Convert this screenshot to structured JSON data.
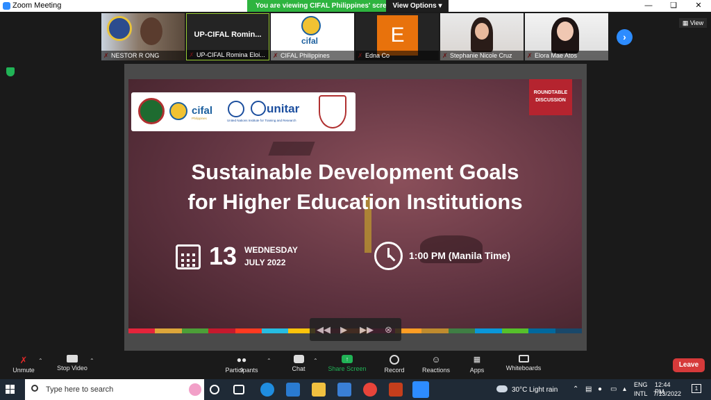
{
  "window": {
    "title": "Zoom Meeting"
  },
  "banner": {
    "viewing_text": "You are viewing CIFAL Philippines' screen",
    "view_options": "View Options"
  },
  "participants": [
    {
      "name": "NESTOR R ONG"
    },
    {
      "name": "UP-CIFAL Romina Eloi...",
      "video_label": "UP-CIFAL Romin..."
    },
    {
      "name": "CIFAL Philippines",
      "logo_text": "cifal"
    },
    {
      "name": "Edna Co",
      "avatar_letter": "E"
    },
    {
      "name": "Stephanie Nicole Cruz"
    },
    {
      "name": "Elora Mae Atos"
    }
  ],
  "view_button": "View",
  "slide": {
    "logo_cifal": "cifal",
    "logo_cifal_sub": "Philippines",
    "logo_unitar": "unitar",
    "logo_unitar_sub": "United Nations Institute for Training and Research",
    "badge_line1": "ROUNDTABLE",
    "badge_line2": "DISCUSSION",
    "headline_line1": "Sustainable Development Goals",
    "headline_line2": "for Higher Education Institutions",
    "day": "13",
    "weekday": "WEDNESDAY",
    "month_year": "JULY 2022",
    "time": "1:00 PM (Manila Time)",
    "sdg_colors": [
      "#e5243b",
      "#dda63a",
      "#4c9f38",
      "#c5192d",
      "#ff3a21",
      "#26bde2",
      "#fcc30b",
      "#a21942",
      "#fd6925",
      "#dd1367",
      "#fd9d24",
      "#bf8b2e",
      "#3f7e44",
      "#0a97d9",
      "#56c02b",
      "#00689d",
      "#19486a"
    ]
  },
  "toolbar": {
    "unmute": "Unmute",
    "stop_video": "Stop Video",
    "participants": "Participants",
    "participants_count": "9",
    "chat": "Chat",
    "share_screen": "Share Screen",
    "record": "Record",
    "reactions": "Reactions",
    "apps": "Apps",
    "whiteboards": "Whiteboards",
    "leave": "Leave"
  },
  "taskbar": {
    "search_placeholder": "Type here to search",
    "weather": "30°C  Light rain",
    "lang_line1": "ENG",
    "lang_line2": "INTL",
    "clock_time": "12:44 PM",
    "clock_date": "7/13/2022",
    "notification_count": "1"
  }
}
